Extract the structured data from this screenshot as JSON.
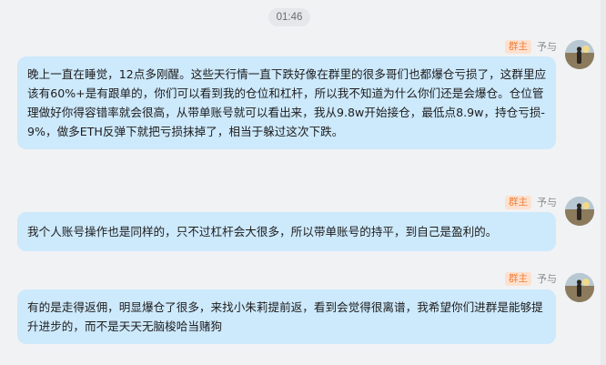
{
  "timestamp": "01:46",
  "messages": [
    {
      "badge": "群主",
      "sender": "予与",
      "text": "晚上一直在睡觉，12点多刚醒。这些天行情一直下跌好像在群里的很多哥们也都爆仓亏损了，这群里应该有60%+是有跟单的，你们可以看到我的仓位和杠杆，所以我不知道为什么你们还是会爆仓。仓位管理做好你得容错率就会很高，从带单账号就可以看出来，我从9.8w开始接仓，最低点8.9w，持仓亏损-9%，做多ETH反弹下就把亏损抹掉了，相当于躲过这次下跌。"
    },
    {
      "badge": "群主",
      "sender": "予与",
      "text": "我个人账号操作也是同样的，只不过杠杆会大很多，所以带单账号的持平，到自己是盈利的。"
    },
    {
      "badge": "群主",
      "sender": "予与",
      "text": "有的是走得返佣，明显爆仓了很多，来找小朱莉提前返，看到会觉得很离谱，我希望你们进群是能够提升进步的，而不是天天无脑梭哈当赌狗"
    }
  ],
  "icons": {
    "avatar": "avatar-icon"
  }
}
